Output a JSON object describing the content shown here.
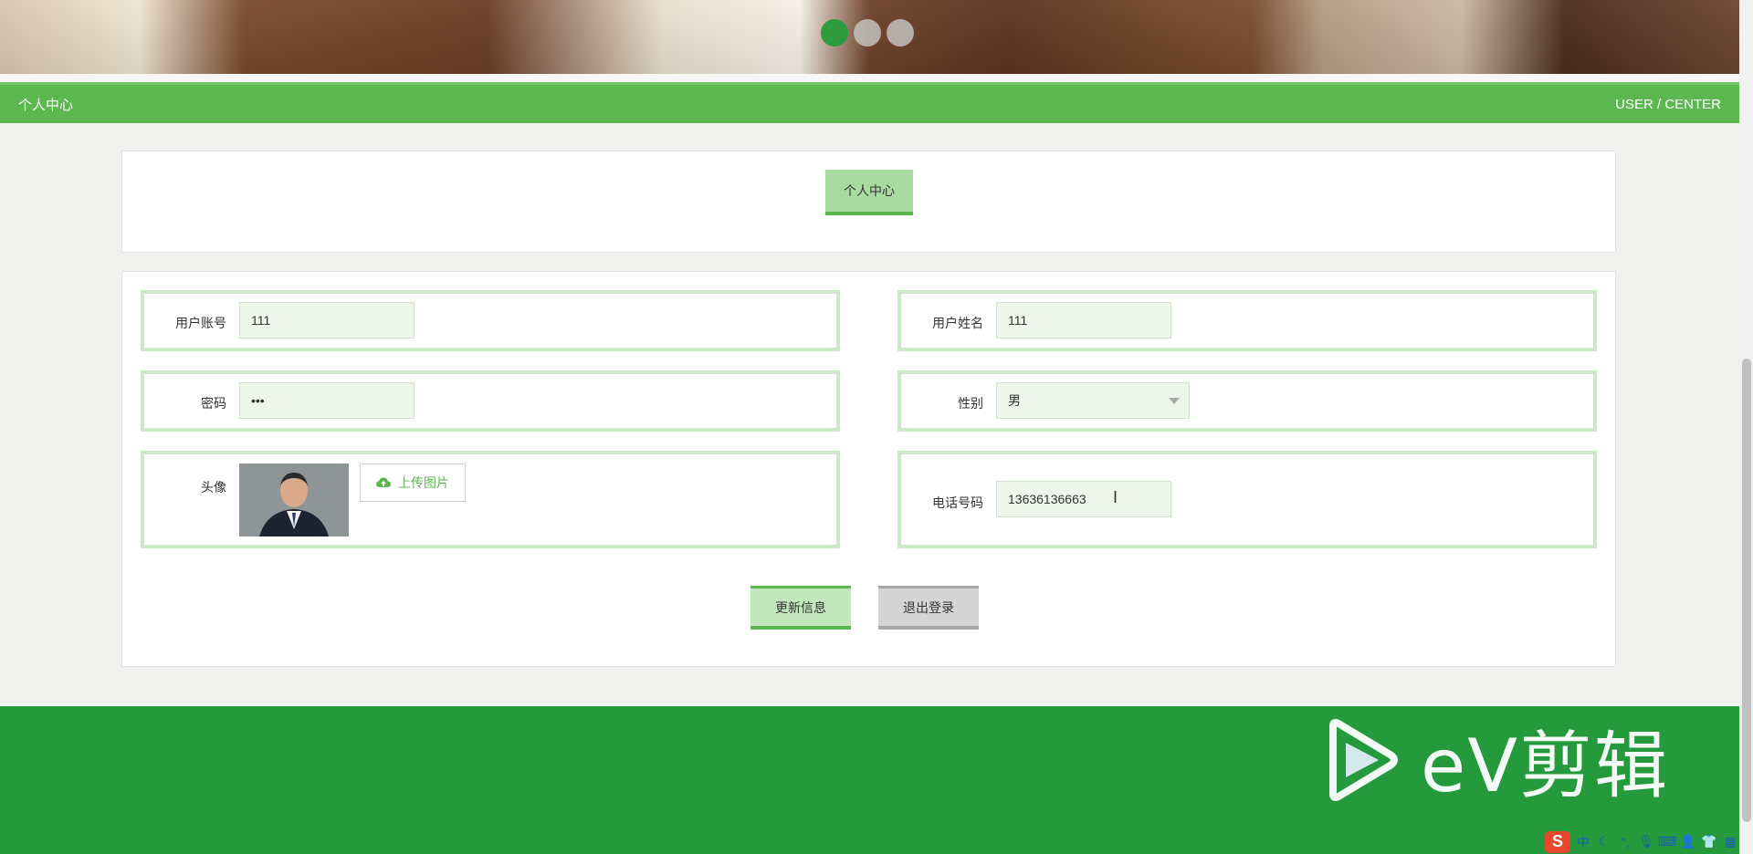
{
  "banner": {
    "active_dot": 0,
    "dot_count": 3
  },
  "titlebar": {
    "left": "个人中心",
    "right": "USER / CENTER"
  },
  "page": {
    "heading": "个人中心"
  },
  "form": {
    "account": {
      "label": "用户账号",
      "value": "111"
    },
    "name": {
      "label": "用户姓名",
      "value": "111"
    },
    "password": {
      "label": "密码",
      "value": "•••"
    },
    "gender": {
      "label": "性别",
      "value": "男"
    },
    "avatar": {
      "label": "头像",
      "upload_label": "上传图片"
    },
    "phone": {
      "label": "电话号码",
      "value": "13636136663"
    }
  },
  "actions": {
    "update": "更新信息",
    "logout": "退出登录"
  },
  "watermark": {
    "text": "eV剪辑"
  },
  "tray": {
    "ime": "中",
    "logo": "S"
  }
}
